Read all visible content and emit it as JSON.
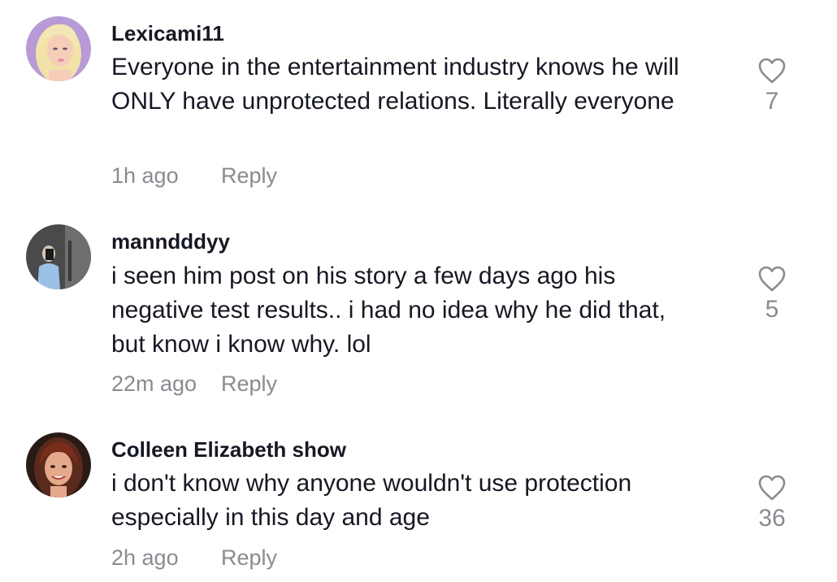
{
  "comments": [
    {
      "username": "Lexicami11",
      "text": "Everyone in the entertainment industry knows he will ONLY have unprotected relations. Literally everyone",
      "time": "1h ago",
      "reply_label": "Reply",
      "like_count": "7",
      "avatar_icon": "blonde-doll-avatar"
    },
    {
      "username": "manndddyy",
      "text": "i seen him post on his story a few days ago his negative test results.. i had no idea why he did that, but know i know why. lol",
      "time": "22m ago",
      "reply_label": "Reply",
      "like_count": "5",
      "avatar_icon": "mirror-selfie-avatar"
    },
    {
      "username": "Colleen Elizabeth show",
      "text": "i don't know why anyone wouldn't use protection especially in this day and age",
      "time": "2h ago",
      "reply_label": "Reply",
      "like_count": "36",
      "avatar_icon": "portrait-avatar"
    }
  ],
  "colors": {
    "text": "#161823",
    "secondary": "#8a8b91",
    "heart_outline": "#8a8b91"
  }
}
